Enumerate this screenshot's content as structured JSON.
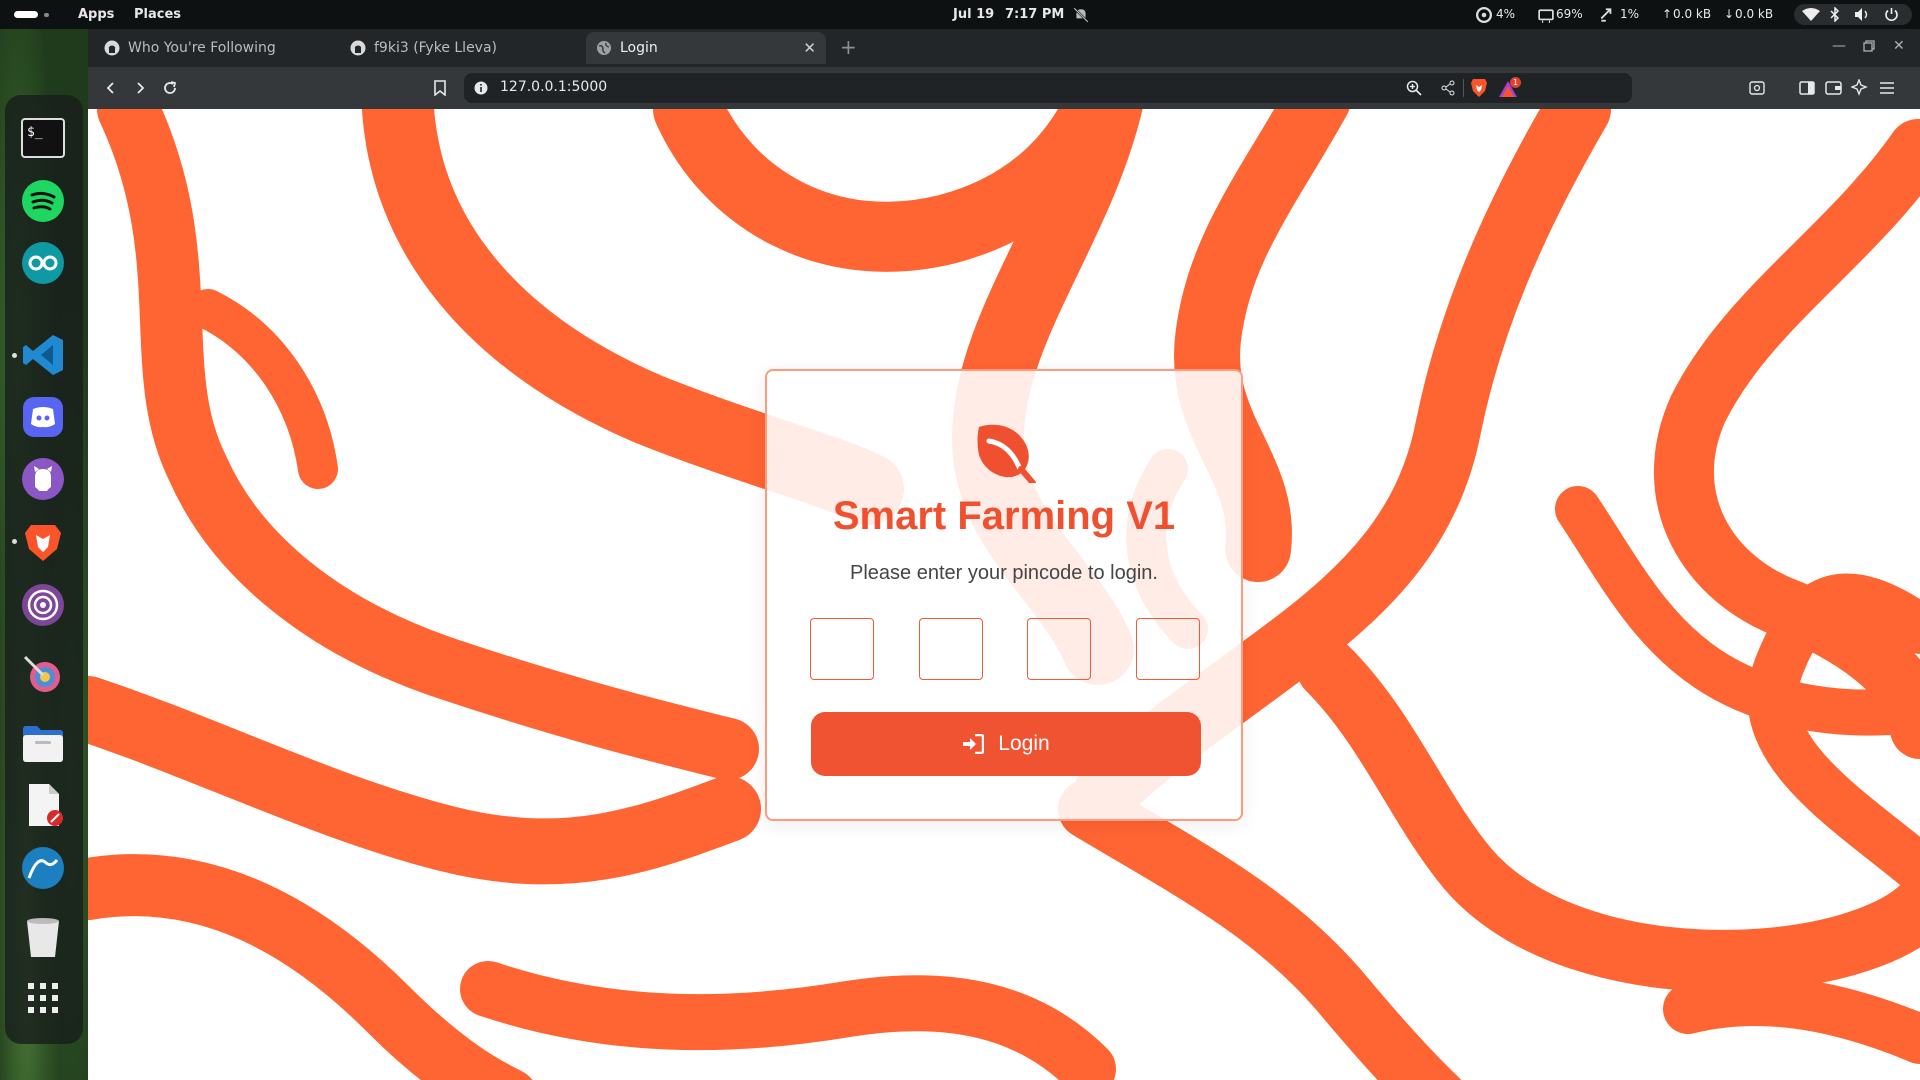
{
  "topbar": {
    "activities_label": "Activities",
    "apps": "Apps",
    "places": "Places",
    "date": "Jul 19",
    "time": "7:17 PM",
    "cpu": "4%",
    "memory": "69%",
    "swap": "1%",
    "upload": "0.0 kB",
    "download": "0.0 kB"
  },
  "dock": {
    "items": [
      {
        "name": "terminal",
        "icon": "terminal-icon"
      },
      {
        "name": "spotify",
        "icon": "spotify-icon"
      },
      {
        "name": "arduino",
        "icon": "arduino-icon"
      },
      {
        "name": "vscode",
        "icon": "vscode-icon"
      },
      {
        "name": "discord",
        "icon": "discord-icon"
      },
      {
        "name": "github-desktop",
        "icon": "github-icon"
      },
      {
        "name": "brave",
        "icon": "brave-icon"
      },
      {
        "name": "tor-browser",
        "icon": "tor-icon"
      },
      {
        "name": "color-picker",
        "icon": "color-picker-icon"
      },
      {
        "name": "files",
        "icon": "folder-icon"
      },
      {
        "name": "text-editor",
        "icon": "text-editor-icon"
      },
      {
        "name": "wireshark",
        "icon": "wireshark-icon"
      },
      {
        "name": "trash",
        "icon": "trash-icon"
      },
      {
        "name": "show-apps",
        "icon": "app-grid-icon"
      }
    ]
  },
  "browser": {
    "tabs": [
      {
        "label": "Who You're Following",
        "icon": "github-icon"
      },
      {
        "label": "f9ki3 (Fyke Lleva)",
        "icon": "github-icon"
      },
      {
        "label": "Login",
        "icon": "globe-icon"
      }
    ],
    "new_tab": "+",
    "url": "127.0.0.1:5000",
    "brave_badge": "1"
  },
  "login": {
    "title": "Smart Farming V1",
    "subtitle": "Please enter your pincode to login.",
    "pins": [
      "",
      "",
      "",
      ""
    ],
    "button_label": "Login"
  },
  "colors": {
    "accent": "#f05332",
    "pattern": "#ff6433"
  }
}
